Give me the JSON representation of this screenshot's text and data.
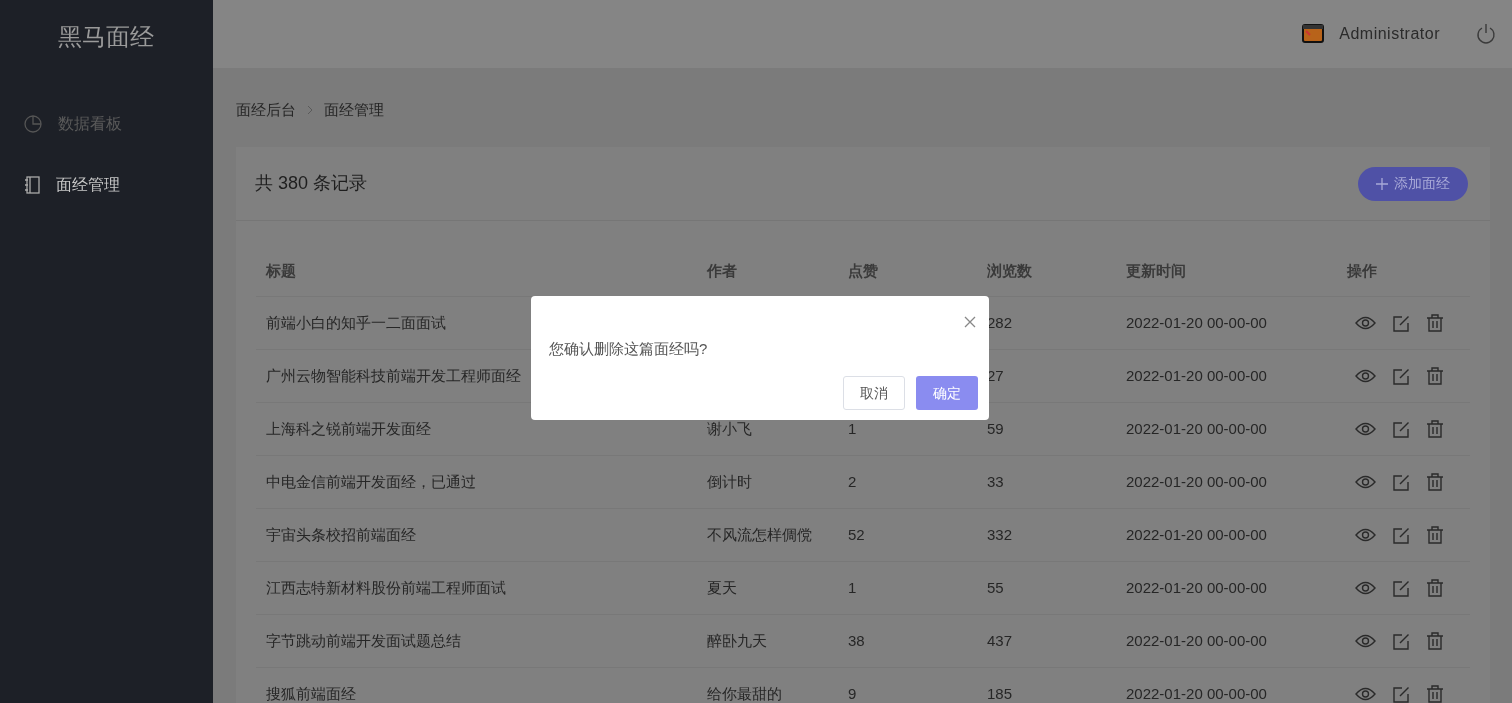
{
  "sidebar": {
    "logo": "黑马面经",
    "items": [
      {
        "label": "数据看板",
        "selected": false
      },
      {
        "label": "面经管理",
        "selected": true
      }
    ]
  },
  "header": {
    "user": "Administrator"
  },
  "breadcrumb": [
    "面经后台",
    "面经管理"
  ],
  "card": {
    "total": "共 380 条记录",
    "add_button": "添加面经"
  },
  "table": {
    "columns": [
      "标题",
      "作者",
      "点赞",
      "浏览数",
      "更新时间",
      "操作"
    ],
    "rows": [
      {
        "title": "前端小白的知乎一二面面试",
        "views": "282",
        "updated": "2022-01-20 00-00-00"
      },
      {
        "title": "广州云物智能科技前端开发工程师面经",
        "views": "27",
        "updated": "2022-01-20 00-00-00"
      },
      {
        "title": "上海科之锐前端开发面经",
        "author": "谢小飞",
        "likes": "1",
        "views": "59",
        "updated": "2022-01-20 00-00-00"
      },
      {
        "title": "中电金信前端开发面经，已通过",
        "author": "倒计时",
        "likes": "2",
        "views": "33",
        "updated": "2022-01-20 00-00-00"
      },
      {
        "title": "宇宙头条校招前端面经",
        "author": "不风流怎样倜傥",
        "likes": "52",
        "views": "332",
        "updated": "2022-01-20 00-00-00"
      },
      {
        "title": "江西志特新材料股份前端工程师面试",
        "author": "夏天",
        "likes": "1",
        "views": "55",
        "updated": "2022-01-20 00-00-00"
      },
      {
        "title": "字节跳动前端开发面试题总结",
        "author": "醉卧九天",
        "likes": "38",
        "views": "437",
        "updated": "2022-01-20 00-00-00"
      },
      {
        "title": "搜狐前端面经",
        "author": "给你最甜的",
        "likes": "9",
        "views": "185",
        "updated": "2022-01-20 00-00-00"
      }
    ]
  },
  "dialog": {
    "message": "您确认删除这篇面经吗?",
    "buttons": [
      {
        "label": "取消",
        "kind": "default"
      },
      {
        "label": "确定",
        "kind": "primary"
      }
    ]
  }
}
